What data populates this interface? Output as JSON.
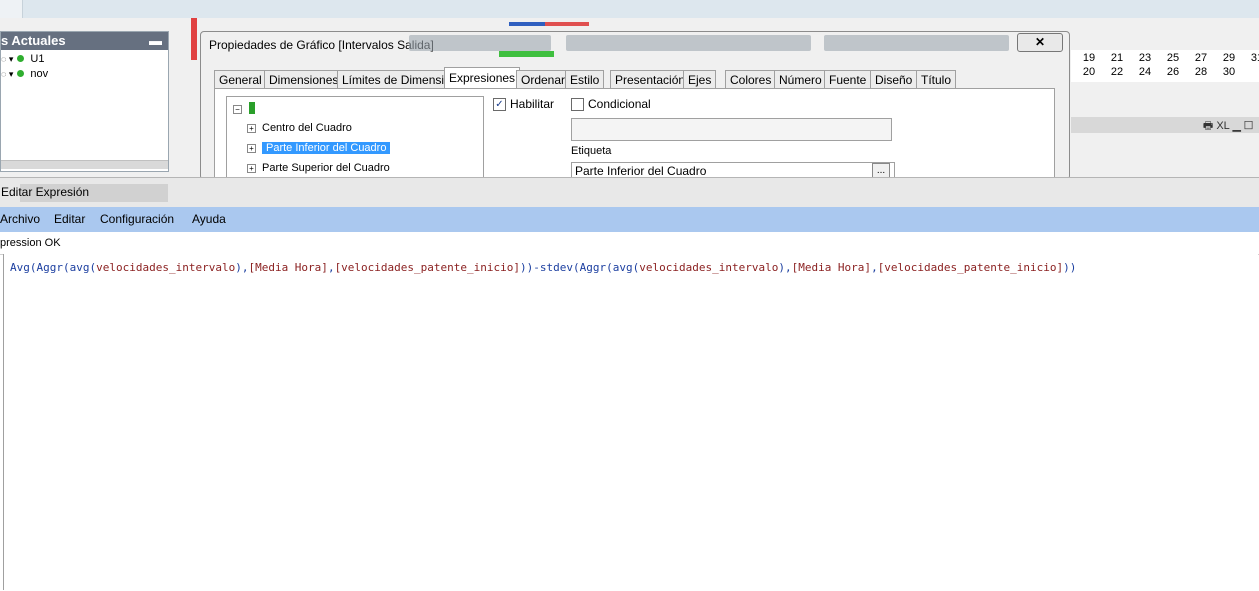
{
  "background": {
    "selection_panel": {
      "title": "s Actuales",
      "minimize_glyph": "▬",
      "items": [
        {
          "label": "U1"
        },
        {
          "label": "nov"
        }
      ]
    },
    "calendar": {
      "row1": [
        "19",
        "21",
        "23",
        "25",
        "27",
        "29",
        "31"
      ],
      "row2": [
        "20",
        "22",
        "24",
        "26",
        "28",
        "30"
      ]
    },
    "object_bar_icons": "🖶 XL ▁ ☐"
  },
  "properties_dialog": {
    "title": "Propiedades de Gráfico [Intervalos Salida]",
    "close_label": "✕",
    "tabs": [
      "General",
      "Dimensiones",
      "Límites de Dimensión",
      "Expresiones",
      "Ordenar",
      "Estilo",
      "Presentación",
      "Ejes",
      "Colores",
      "Número",
      "Fuente",
      "Diseño",
      "Título"
    ],
    "active_tab": "Expresiones",
    "tree": {
      "root_expander": "−",
      "items": [
        {
          "label": "Centro del Cuadro",
          "expander": "+"
        },
        {
          "label": "Parte Inferior del Cuadro",
          "expander": "+",
          "selected": true
        },
        {
          "label": "Parte Superior del Cuadro",
          "expander": "+"
        }
      ]
    },
    "enable_label": "Habilitar",
    "enable_checked": true,
    "conditional_label": "Condicional",
    "conditional_checked": false,
    "conditional_value": "",
    "label_caption": "Etiqueta",
    "label_value": "Parte Inferior del Cuadro",
    "label_button": "..."
  },
  "expression_editor": {
    "title": "Editar Expresión",
    "menu": [
      "Archivo",
      "Editar",
      "Configuración",
      "Ayuda"
    ],
    "status": "pression OK",
    "code_tokens": [
      {
        "t": "Avg",
        "c": "fn"
      },
      {
        "t": "(",
        "c": "op"
      },
      {
        "t": "Aggr",
        "c": "fn"
      },
      {
        "t": "(",
        "c": "op"
      },
      {
        "t": "avg",
        "c": "fn"
      },
      {
        "t": "(",
        "c": "op"
      },
      {
        "t": "velocidades_intervalo",
        "c": "fld"
      },
      {
        "t": "),",
        "c": "op"
      },
      {
        "t": "[Media Hora]",
        "c": "fld"
      },
      {
        "t": ",",
        "c": "op"
      },
      {
        "t": "[velocidades_patente_inicio]",
        "c": "fld"
      },
      {
        "t": "))-",
        "c": "op"
      },
      {
        "t": "stdev",
        "c": "fn"
      },
      {
        "t": "(",
        "c": "op"
      },
      {
        "t": "Aggr",
        "c": "fn"
      },
      {
        "t": "(",
        "c": "op"
      },
      {
        "t": "avg",
        "c": "fn"
      },
      {
        "t": "(",
        "c": "op"
      },
      {
        "t": "velocidades_intervalo",
        "c": "fld"
      },
      {
        "t": "),",
        "c": "op"
      },
      {
        "t": "[Media Hora]",
        "c": "fld"
      },
      {
        "t": ",",
        "c": "op"
      },
      {
        "t": "[velocidades_patente_inicio]",
        "c": "fld"
      },
      {
        "t": "))",
        "c": "op"
      }
    ]
  },
  "colors": {
    "menu_bar": "#aac8ef",
    "selection": "#3399ff",
    "function_token": "#1c3fa0",
    "field_token": "#8a1f1f"
  }
}
